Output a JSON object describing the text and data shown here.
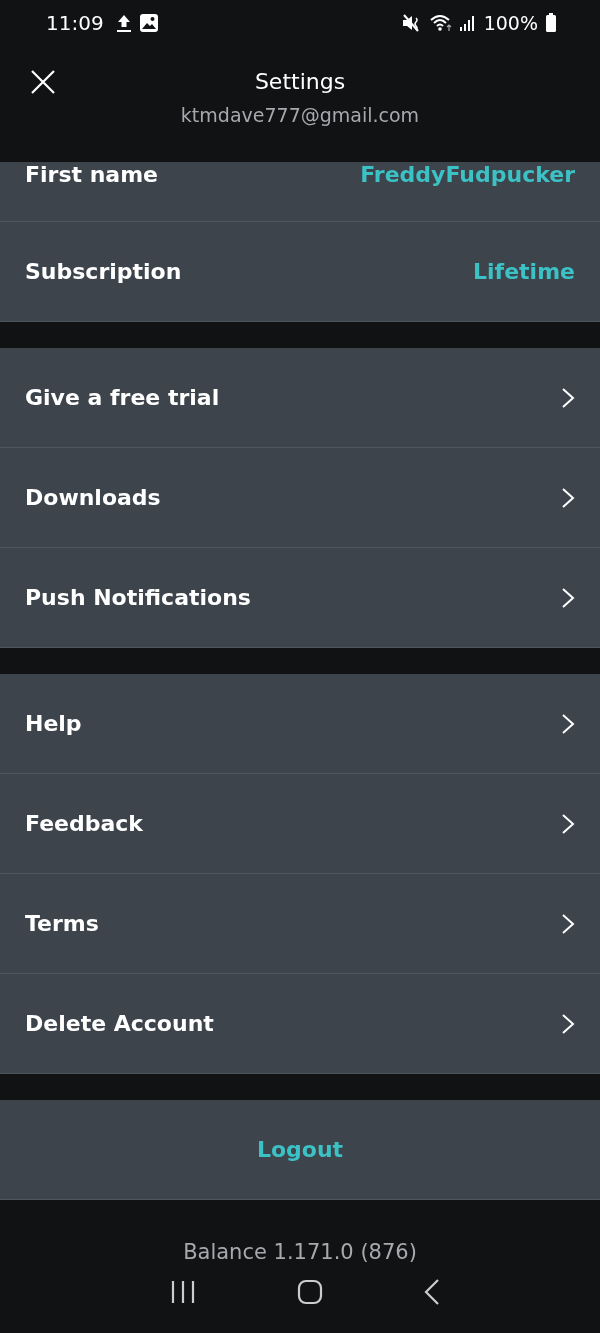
{
  "status_bar": {
    "time": "11:09",
    "battery": "100%"
  },
  "header": {
    "title": "Settings",
    "subtitle": "ktmdave777@gmail.com"
  },
  "sections": [
    {
      "rows": [
        {
          "kind": "value",
          "label": "First name",
          "value": "FreddyFudpucker",
          "partial": true
        },
        {
          "kind": "value",
          "label": "Subscription",
          "value": "Lifetime"
        }
      ]
    },
    {
      "rows": [
        {
          "kind": "link",
          "label": "Give a free trial"
        },
        {
          "kind": "link",
          "label": "Downloads"
        },
        {
          "kind": "link",
          "label": "Push Notifications"
        }
      ]
    },
    {
      "rows": [
        {
          "kind": "link",
          "label": "Help"
        },
        {
          "kind": "link",
          "label": "Feedback"
        },
        {
          "kind": "link",
          "label": "Terms"
        },
        {
          "kind": "link",
          "label": "Delete Account"
        }
      ]
    },
    {
      "rows": [
        {
          "kind": "action",
          "label": "Logout"
        }
      ]
    }
  ],
  "footer": {
    "version": "Balance 1.171.0 (876)"
  }
}
